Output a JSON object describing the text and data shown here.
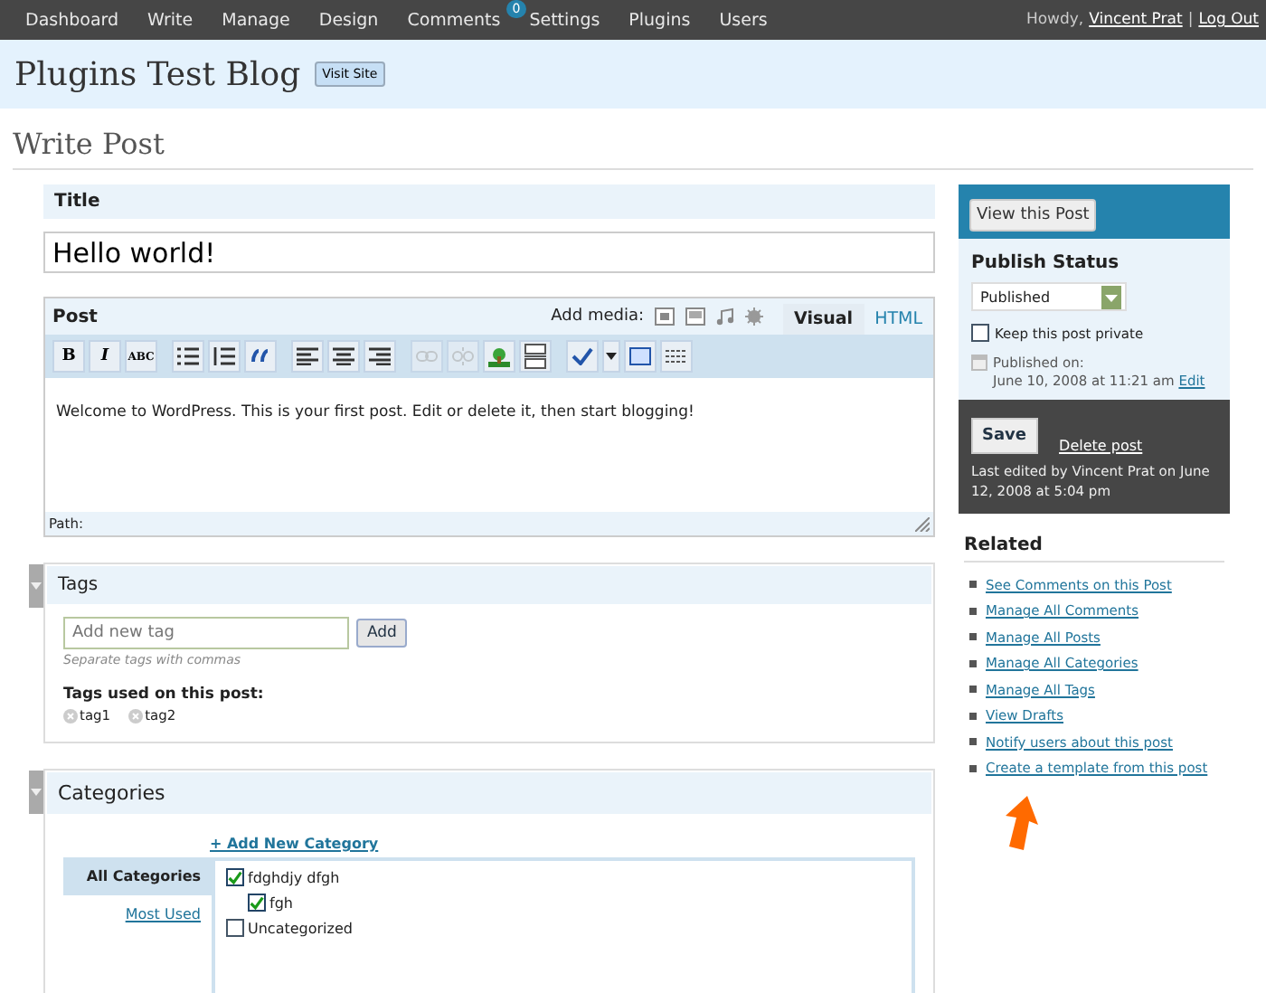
{
  "nav": {
    "items": [
      {
        "label": "Dashboard"
      },
      {
        "label": "Write"
      },
      {
        "label": "Manage"
      },
      {
        "label": "Design"
      },
      {
        "label": "Comments",
        "badge": "0"
      },
      {
        "label": "Settings"
      },
      {
        "label": "Plugins"
      },
      {
        "label": "Users"
      }
    ],
    "greeting": "Howdy,",
    "user": "Vincent Prat",
    "separator": "|",
    "logout": "Log Out"
  },
  "header": {
    "blog_title": "Plugins Test Blog",
    "visit_button": "Visit Site"
  },
  "page_title": "Write Post",
  "title_box": {
    "heading": "Title",
    "value": "Hello world!"
  },
  "post_box": {
    "heading": "Post",
    "add_media": "Add media:",
    "tabs": [
      {
        "label": "Visual",
        "selected": true
      },
      {
        "label": "HTML",
        "selected": false
      }
    ],
    "toolbar": [
      {
        "label": "B",
        "kind": "bold"
      },
      {
        "label": "I",
        "kind": "italic"
      },
      {
        "label": "ABC",
        "kind": "strike"
      }
    ],
    "content": "Welcome to WordPress. This is your first post. Edit or delete it, then start blogging!",
    "path_label": "Path:"
  },
  "tags_box": {
    "heading": "Tags",
    "placeholder": "Add new tag",
    "add_button": "Add",
    "hint": "Separate tags with commas",
    "used_label": "Tags used on this post:",
    "tags": [
      "tag1",
      "tag2"
    ]
  },
  "categories_box": {
    "heading": "Categories",
    "add_link": "+ Add New Category",
    "tabs": [
      {
        "label": "All Categories",
        "selected": true
      },
      {
        "label": "Most Used",
        "selected": false
      }
    ],
    "items": [
      {
        "label": "fdghdjy dfgh",
        "checked": true,
        "children": [
          {
            "label": "fgh",
            "checked": true
          }
        ]
      },
      {
        "label": "Uncategorized",
        "checked": false
      }
    ]
  },
  "sidebar": {
    "view_button": "View this Post",
    "status_heading": "Publish Status",
    "status_value": "Published",
    "private_label": "Keep this post private",
    "private_checked": false,
    "published_label": "Published on:",
    "published_date": "June 10, 2008 at 11:21 am",
    "edit_link": "Edit",
    "save_button": "Save",
    "delete_link": "Delete post",
    "last_edited": "Last edited by Vincent Prat on June 12, 2008 at 5:04 pm"
  },
  "related": {
    "heading": "Related",
    "links": [
      "See Comments on this Post",
      "Manage All Comments",
      "Manage All Posts",
      "Manage All Categories",
      "Manage All Tags",
      "View Drafts",
      "Notify users about this post",
      "Create a template from this post"
    ]
  }
}
